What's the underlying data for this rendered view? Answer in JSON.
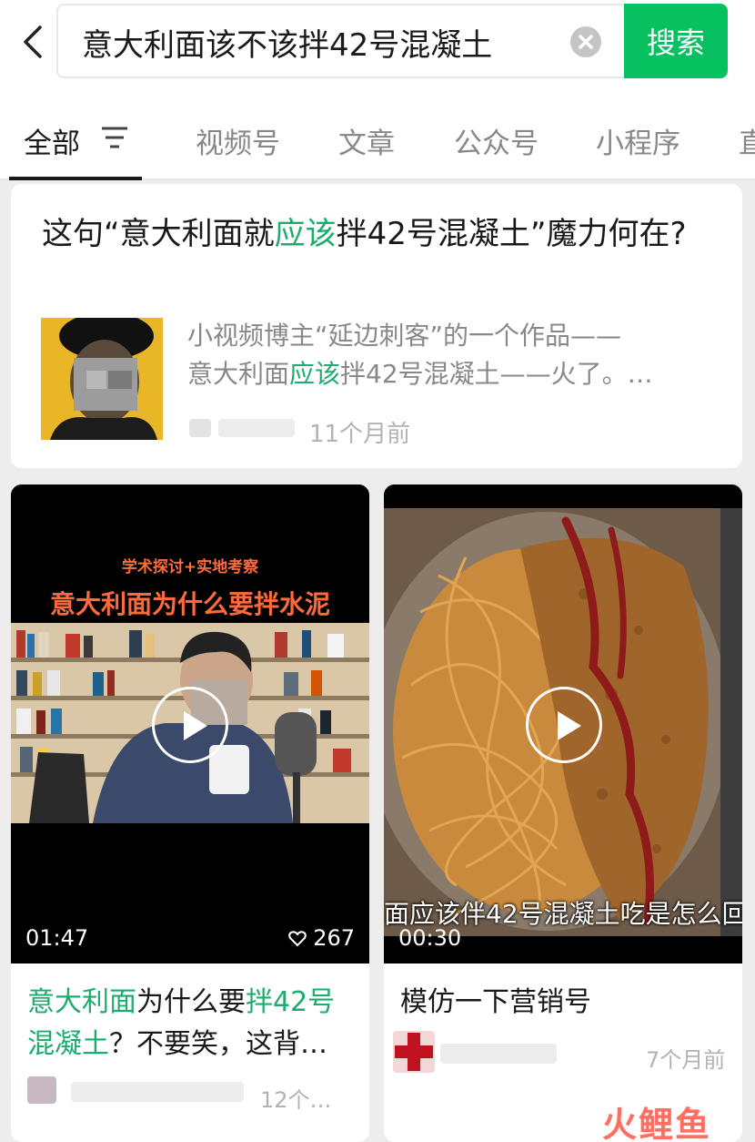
{
  "search": {
    "query": "意大利面该不该拌42号混凝土",
    "button_label": "搜索"
  },
  "tabs": [
    {
      "label": "全部"
    },
    {
      "label": "视频号"
    },
    {
      "label": "文章"
    },
    {
      "label": "公众号"
    },
    {
      "label": "小程序"
    },
    {
      "label": "直"
    }
  ],
  "article": {
    "title_pre": "这句“意大利面就",
    "title_hl": "应该",
    "title_post": "拌42号混凝土”魔力何在?",
    "summary_line1": "小视频博主“延边刺客”的一个作品——",
    "summary_pre": "意大利面",
    "summary_hl": "应该",
    "summary_post": "拌42号混凝土——火了。…",
    "time": "11个月前"
  },
  "videos": [
    {
      "overlay_top": "学术探讨+实地考察",
      "overlay_main": "意大利面为什么要拌水泥",
      "duration": "01:47",
      "likes": "267",
      "title_hl1": "意大利面",
      "title_mid": "为什么要",
      "title_hl2": "拌42号",
      "title_hl3": "混凝土",
      "title_post": "？不要笑，这背…",
      "time": "12个…"
    },
    {
      "caption": "面应该伴42号混凝土吃是怎么回",
      "duration": "00:30",
      "title": "模仿一下营销号",
      "time": "7个月前"
    }
  ],
  "watermark": "火鲤鱼",
  "colors": {
    "accent": "#07c160",
    "highlight": "#1aad6d",
    "watermark": "#ff6f61"
  }
}
